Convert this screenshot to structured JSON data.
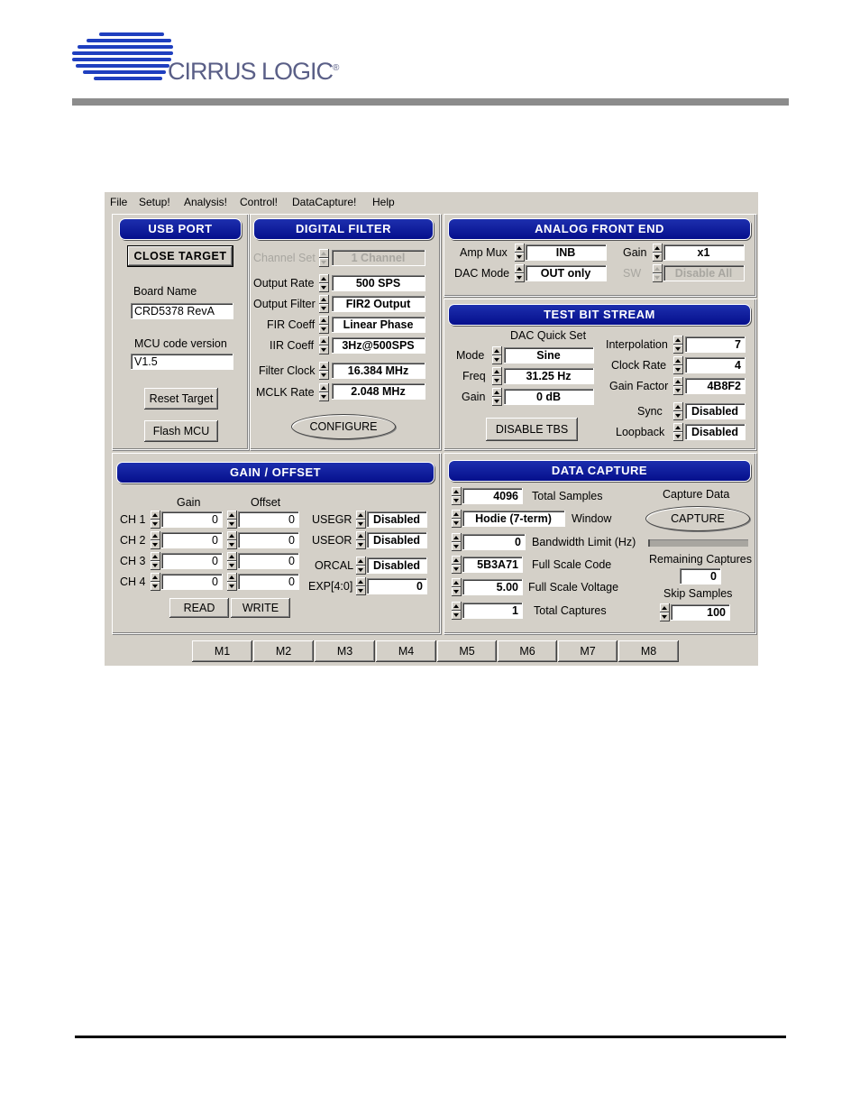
{
  "header": {
    "logo_text": "CIRRUS LOGIC",
    "logo_mark": "®",
    "brand_color": "#1f3fbf",
    "bar_color": "#8c8c8c"
  },
  "menu": [
    "File",
    "Setup!",
    "Analysis!",
    "Control!",
    "DataCapture!",
    "Help"
  ],
  "usb_port": {
    "title": "USB PORT",
    "close_target": "CLOSE TARGET",
    "board_name_label": "Board Name",
    "board_name": "CRD5378 RevA",
    "mcu_label": "MCU code version",
    "mcu_version": "V1.5",
    "reset_target": "Reset Target",
    "flash_mcu": "Flash MCU"
  },
  "digital_filter": {
    "title": "DIGITAL FILTER",
    "channel_set_label": "Channel Set",
    "channel_set": "1 Channel",
    "output_rate_label": "Output Rate",
    "output_rate": "500 SPS",
    "output_filter_label": "Output Filter",
    "output_filter": "FIR2 Output",
    "fir_coeff_label": "FIR Coeff",
    "fir_coeff": "Linear Phase",
    "iir_coeff_label": "IIR Coeff",
    "iir_coeff": "3Hz@500SPS",
    "filter_clock_label": "Filter Clock",
    "filter_clock": "16.384 MHz",
    "mclk_rate_label": "MCLK Rate",
    "mclk_rate": "2.048 MHz",
    "configure": "CONFIGURE"
  },
  "analog_front_end": {
    "title": "ANALOG FRONT END",
    "amp_mux_label": "Amp Mux",
    "amp_mux": "INB",
    "gain_label": "Gain",
    "gain": "x1",
    "dac_mode_label": "DAC Mode",
    "dac_mode": "OUT only",
    "sw_label": "SW",
    "sw": "Disable All"
  },
  "test_bit_stream": {
    "title": "TEST BIT STREAM",
    "dac_quick_set": "DAC Quick Set",
    "mode_label": "Mode",
    "mode": "Sine",
    "freq_label": "Freq",
    "freq": "31.25 Hz",
    "gain_label": "Gain",
    "gain": "0 dB",
    "disable_tbs": "DISABLE TBS",
    "interpolation_label": "Interpolation",
    "interpolation": "7",
    "clock_rate_label": "Clock Rate",
    "clock_rate": "4",
    "gain_factor_label": "Gain Factor",
    "gain_factor": "4B8F2",
    "sync_label": "Sync",
    "sync": "Disabled",
    "loopback_label": "Loopback",
    "loopback": "Disabled"
  },
  "gain_offset": {
    "title": "GAIN / OFFSET",
    "gain_header": "Gain",
    "offset_header": "Offset",
    "channels": [
      {
        "label": "CH 1",
        "gain": "0",
        "offset": "0"
      },
      {
        "label": "CH 2",
        "gain": "0",
        "offset": "0"
      },
      {
        "label": "CH 3",
        "gain": "0",
        "offset": "0"
      },
      {
        "label": "CH 4",
        "gain": "0",
        "offset": "0"
      }
    ],
    "usegr_label": "USEGR",
    "usegr": "Disabled",
    "useor_label": "USEOR",
    "useor": "Disabled",
    "orcal_label": "ORCAL",
    "orcal": "Disabled",
    "exp_label": "EXP[4:0]",
    "exp": "0",
    "read": "READ",
    "write": "WRITE"
  },
  "data_capture": {
    "title": "DATA CAPTURE",
    "total_samples": "4096",
    "total_samples_label": "Total Samples",
    "window": "Hodie (7-term)",
    "window_label": "Window",
    "bandwidth": "0",
    "bandwidth_label": "Bandwidth Limit (Hz)",
    "full_scale_code": "5B3A71",
    "full_scale_code_label": "Full Scale Code",
    "full_scale_voltage": "5.00",
    "full_scale_voltage_label": "Full Scale Voltage",
    "total_captures": "1",
    "total_captures_label": "Total Captures",
    "capture_data_label": "Capture Data",
    "capture": "CAPTURE",
    "capture_progress": 0.02,
    "remaining_label": "Remaining Captures",
    "remaining": "0",
    "skip_label": "Skip Samples",
    "skip": "100"
  },
  "macros": [
    "M1",
    "M2",
    "M3",
    "M4",
    "M5",
    "M6",
    "M7",
    "M8"
  ]
}
